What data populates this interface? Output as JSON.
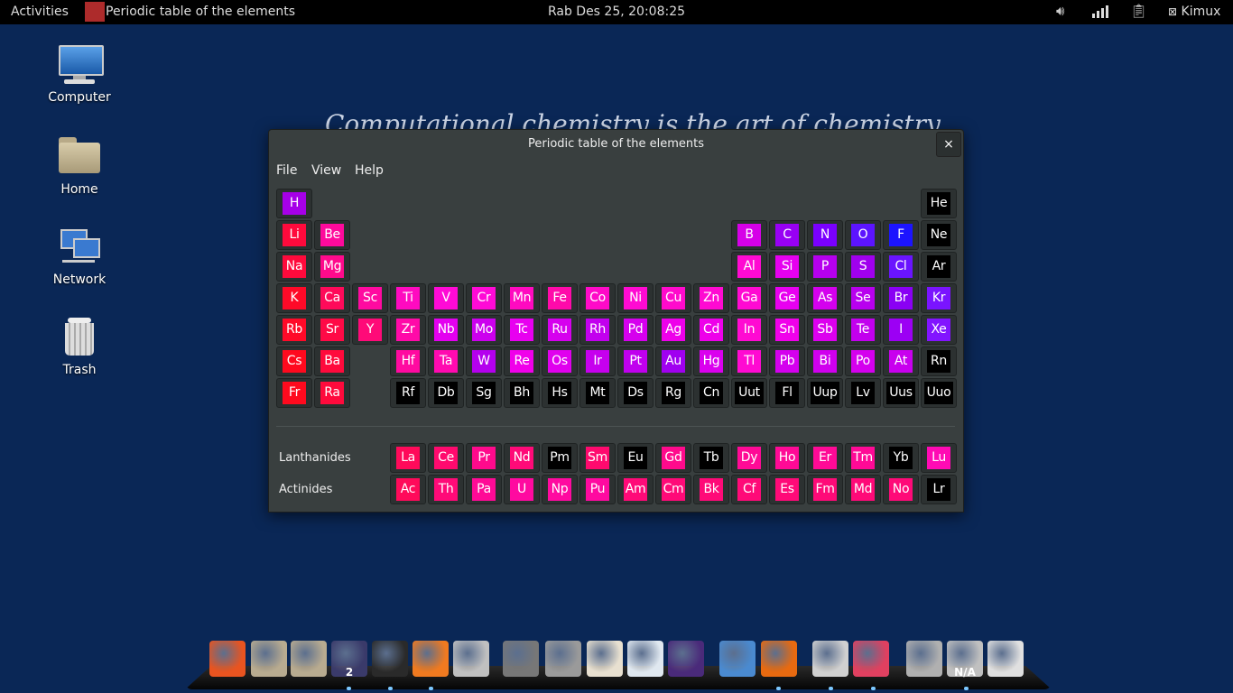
{
  "topbar": {
    "activities": "Activities",
    "app_title": "Periodic table of the elements",
    "clock": "Rab Des 25, 20:08:25",
    "user": "Kimux",
    "icons": [
      "volume-icon",
      "signal-icon",
      "clipboard-icon",
      "user-icon"
    ]
  },
  "desktop": {
    "icons": [
      {
        "label": "Computer",
        "icon": "computer-icon"
      },
      {
        "label": "Home",
        "icon": "home-folder-icon"
      },
      {
        "label": "Network",
        "icon": "network-icon"
      },
      {
        "label": "Trash",
        "icon": "trash-icon"
      }
    ],
    "quote": "Computational chemistry is the art of chemistry"
  },
  "window": {
    "title": "Periodic table of the elements",
    "close": "×",
    "menu": [
      "File",
      "View",
      "Help"
    ],
    "lanthanides_label": "Lanthanides",
    "actinides_label": "Actinides",
    "elements": [
      {
        "s": "H",
        "p": 1,
        "g": 1,
        "c": "#a600e8"
      },
      {
        "s": "He",
        "p": 1,
        "g": 18,
        "c": "#000000"
      },
      {
        "s": "Li",
        "p": 2,
        "g": 1,
        "c": "#ff0a3c"
      },
      {
        "s": "Be",
        "p": 2,
        "g": 2,
        "c": "#ff0a9c"
      },
      {
        "s": "B",
        "p": 2,
        "g": 13,
        "c": "#d600e8"
      },
      {
        "s": "C",
        "p": 2,
        "g": 14,
        "c": "#9800f4"
      },
      {
        "s": "N",
        "p": 2,
        "g": 15,
        "c": "#7a00ff"
      },
      {
        "s": "O",
        "p": 2,
        "g": 16,
        "c": "#5c14ff"
      },
      {
        "s": "F",
        "p": 2,
        "g": 17,
        "c": "#1c14ff"
      },
      {
        "s": "Ne",
        "p": 2,
        "g": 18,
        "c": "#000000"
      },
      {
        "s": "Na",
        "p": 3,
        "g": 1,
        "c": "#ff0a3c"
      },
      {
        "s": "Mg",
        "p": 3,
        "g": 2,
        "c": "#ff0a8c"
      },
      {
        "s": "Al",
        "p": 3,
        "g": 13,
        "c": "#ff0ad2"
      },
      {
        "s": "Si",
        "p": 3,
        "g": 14,
        "c": "#e600f0"
      },
      {
        "s": "P",
        "p": 3,
        "g": 15,
        "c": "#b600ee"
      },
      {
        "s": "S",
        "p": 3,
        "g": 16,
        "c": "#a000ee"
      },
      {
        "s": "Cl",
        "p": 3,
        "g": 17,
        "c": "#6a14ff"
      },
      {
        "s": "Ar",
        "p": 3,
        "g": 18,
        "c": "#000000"
      },
      {
        "s": "K",
        "p": 4,
        "g": 1,
        "c": "#ff0a28"
      },
      {
        "s": "Ca",
        "p": 4,
        "g": 2,
        "c": "#ff0a5a"
      },
      {
        "s": "Sc",
        "p": 4,
        "g": 3,
        "c": "#ff0aa0"
      },
      {
        "s": "Ti",
        "p": 4,
        "g": 4,
        "c": "#ff0ac0"
      },
      {
        "s": "V",
        "p": 4,
        "g": 5,
        "c": "#ff0ad6"
      },
      {
        "s": "Cr",
        "p": 4,
        "g": 6,
        "c": "#ff0ad6"
      },
      {
        "s": "Mn",
        "p": 4,
        "g": 7,
        "c": "#ff0ac0"
      },
      {
        "s": "Fe",
        "p": 4,
        "g": 8,
        "c": "#ff0aaa"
      },
      {
        "s": "Co",
        "p": 4,
        "g": 9,
        "c": "#ff0ac8"
      },
      {
        "s": "Ni",
        "p": 4,
        "g": 10,
        "c": "#ff0ad2"
      },
      {
        "s": "Cu",
        "p": 4,
        "g": 11,
        "c": "#ff0acc"
      },
      {
        "s": "Zn",
        "p": 4,
        "g": 12,
        "c": "#ff0ad2"
      },
      {
        "s": "Ga",
        "p": 4,
        "g": 13,
        "c": "#ff0ad2"
      },
      {
        "s": "Ge",
        "p": 4,
        "g": 14,
        "c": "#e800f0"
      },
      {
        "s": "As",
        "p": 4,
        "g": 15,
        "c": "#d400ee"
      },
      {
        "s": "Se",
        "p": 4,
        "g": 16,
        "c": "#b800ee"
      },
      {
        "s": "Br",
        "p": 4,
        "g": 17,
        "c": "#8a00f4"
      },
      {
        "s": "Kr",
        "p": 4,
        "g": 18,
        "c": "#7a14ff"
      },
      {
        "s": "Rb",
        "p": 5,
        "g": 1,
        "c": "#ff0a28"
      },
      {
        "s": "Sr",
        "p": 5,
        "g": 2,
        "c": "#ff0a46"
      },
      {
        "s": "Y",
        "p": 5,
        "g": 3,
        "c": "#ff0a78"
      },
      {
        "s": "Zr",
        "p": 5,
        "g": 4,
        "c": "#ff0aa8"
      },
      {
        "s": "Nb",
        "p": 5,
        "g": 5,
        "c": "#e400f0"
      },
      {
        "s": "Mo",
        "p": 5,
        "g": 6,
        "c": "#cc00ee"
      },
      {
        "s": "Tc",
        "p": 5,
        "g": 7,
        "c": "#e800f0"
      },
      {
        "s": "Ru",
        "p": 5,
        "g": 8,
        "c": "#d600ee"
      },
      {
        "s": "Rh",
        "p": 5,
        "g": 9,
        "c": "#c200ee"
      },
      {
        "s": "Pd",
        "p": 5,
        "g": 10,
        "c": "#d600ee"
      },
      {
        "s": "Ag",
        "p": 5,
        "g": 11,
        "c": "#ee00ea"
      },
      {
        "s": "Cd",
        "p": 5,
        "g": 12,
        "c": "#ee00ea"
      },
      {
        "s": "In",
        "p": 5,
        "g": 13,
        "c": "#ff0ad2"
      },
      {
        "s": "Sn",
        "p": 5,
        "g": 14,
        "c": "#f000ea"
      },
      {
        "s": "Sb",
        "p": 5,
        "g": 15,
        "c": "#dc00ee"
      },
      {
        "s": "Te",
        "p": 5,
        "g": 16,
        "c": "#c200ee"
      },
      {
        "s": "I",
        "p": 5,
        "g": 17,
        "c": "#9c00f4"
      },
      {
        "s": "Xe",
        "p": 5,
        "g": 18,
        "c": "#8214ff"
      },
      {
        "s": "Cs",
        "p": 6,
        "g": 1,
        "c": "#ff0a1e"
      },
      {
        "s": "Ba",
        "p": 6,
        "g": 2,
        "c": "#ff0a3c"
      },
      {
        "s": "Hf",
        "p": 6,
        "g": 4,
        "c": "#ff0aa0"
      },
      {
        "s": "Ta",
        "p": 6,
        "g": 5,
        "c": "#ff0ab0"
      },
      {
        "s": "W",
        "p": 6,
        "g": 6,
        "c": "#b400ee"
      },
      {
        "s": "Re",
        "p": 6,
        "g": 7,
        "c": "#f000ea"
      },
      {
        "s": "Os",
        "p": 6,
        "g": 8,
        "c": "#e000ee"
      },
      {
        "s": "Ir",
        "p": 6,
        "g": 9,
        "c": "#c600ee"
      },
      {
        "s": "Pt",
        "p": 6,
        "g": 10,
        "c": "#c000ee"
      },
      {
        "s": "Au",
        "p": 6,
        "g": 11,
        "c": "#a000f0"
      },
      {
        "s": "Hg",
        "p": 6,
        "g": 12,
        "c": "#da00ee"
      },
      {
        "s": "Tl",
        "p": 6,
        "g": 13,
        "c": "#ff0ad2"
      },
      {
        "s": "Pb",
        "p": 6,
        "g": 14,
        "c": "#d400ee"
      },
      {
        "s": "Bi",
        "p": 6,
        "g": 15,
        "c": "#d000ee"
      },
      {
        "s": "Po",
        "p": 6,
        "g": 16,
        "c": "#d400ee"
      },
      {
        "s": "At",
        "p": 6,
        "g": 17,
        "c": "#c800ee"
      },
      {
        "s": "Rn",
        "p": 6,
        "g": 18,
        "c": "#000000"
      },
      {
        "s": "Fr",
        "p": 7,
        "g": 1,
        "c": "#ff0a1e"
      },
      {
        "s": "Ra",
        "p": 7,
        "g": 2,
        "c": "#ff0a3c"
      },
      {
        "s": "Rf",
        "p": 7,
        "g": 4,
        "c": "#000000"
      },
      {
        "s": "Db",
        "p": 7,
        "g": 5,
        "c": "#000000"
      },
      {
        "s": "Sg",
        "p": 7,
        "g": 6,
        "c": "#000000"
      },
      {
        "s": "Bh",
        "p": 7,
        "g": 7,
        "c": "#000000"
      },
      {
        "s": "Hs",
        "p": 7,
        "g": 8,
        "c": "#000000"
      },
      {
        "s": "Mt",
        "p": 7,
        "g": 9,
        "c": "#000000"
      },
      {
        "s": "Ds",
        "p": 7,
        "g": 10,
        "c": "#000000"
      },
      {
        "s": "Rg",
        "p": 7,
        "g": 11,
        "c": "#000000"
      },
      {
        "s": "Cn",
        "p": 7,
        "g": 12,
        "c": "#000000"
      },
      {
        "s": "Uut",
        "p": 7,
        "g": 13,
        "c": "#000000"
      },
      {
        "s": "Fl",
        "p": 7,
        "g": 14,
        "c": "#000000"
      },
      {
        "s": "Uup",
        "p": 7,
        "g": 15,
        "c": "#000000"
      },
      {
        "s": "Lv",
        "p": 7,
        "g": 16,
        "c": "#000000"
      },
      {
        "s": "Uus",
        "p": 7,
        "g": 17,
        "c": "#000000"
      },
      {
        "s": "Uuo",
        "p": 7,
        "g": 18,
        "c": "#000000"
      }
    ],
    "lanthanides": [
      {
        "s": "La",
        "c": "#ff0a5a"
      },
      {
        "s": "Ce",
        "c": "#ff0a6e"
      },
      {
        "s": "Pr",
        "c": "#ff0a8c"
      },
      {
        "s": "Nd",
        "c": "#ff0a78"
      },
      {
        "s": "Pm",
        "c": "#000000"
      },
      {
        "s": "Sm",
        "c": "#ff0a6e"
      },
      {
        "s": "Eu",
        "c": "#000000"
      },
      {
        "s": "Gd",
        "c": "#ff0a8c"
      },
      {
        "s": "Tb",
        "c": "#000000"
      },
      {
        "s": "Dy",
        "c": "#ff0a96"
      },
      {
        "s": "Ho",
        "c": "#ff0a96"
      },
      {
        "s": "Er",
        "c": "#ff0a96"
      },
      {
        "s": "Tm",
        "c": "#ff0a96"
      },
      {
        "s": "Yb",
        "c": "#000000"
      },
      {
        "s": "Lu",
        "c": "#ff0ab4"
      }
    ],
    "actinides": [
      {
        "s": "Ac",
        "c": "#ff0a5a"
      },
      {
        "s": "Th",
        "c": "#ff0a78"
      },
      {
        "s": "Pa",
        "c": "#ff0a96"
      },
      {
        "s": "U",
        "c": "#ff0aa0"
      },
      {
        "s": "Np",
        "c": "#ff0aa0"
      },
      {
        "s": "Pu",
        "c": "#ff0aa0"
      },
      {
        "s": "Am",
        "c": "#ff0a78"
      },
      {
        "s": "Cm",
        "c": "#ff0a78"
      },
      {
        "s": "Bk",
        "c": "#ff0a78"
      },
      {
        "s": "Cf",
        "c": "#ff0a78"
      },
      {
        "s": "Es",
        "c": "#ff0a78"
      },
      {
        "s": "Fm",
        "c": "#ff0a78"
      },
      {
        "s": "Md",
        "c": "#ff0a78"
      },
      {
        "s": "No",
        "c": "#ff0a78"
      },
      {
        "s": "Lr",
        "c": "#000000"
      }
    ]
  },
  "dock": {
    "items": [
      {
        "name": "ubuntu-icon",
        "color": "#e95420"
      },
      {
        "name": "folder-icon",
        "color": "#b8ab90"
      },
      {
        "name": "folder-icon",
        "color": "#b8ab90"
      },
      {
        "name": "workspace-switcher-icon",
        "color": "#3a3a6a",
        "badge": "2"
      },
      {
        "name": "terminal-icon",
        "color": "#2a2a2a"
      },
      {
        "name": "software-center-icon",
        "color": "#f07a20"
      },
      {
        "name": "archive-manager-icon",
        "color": "#c0c0c0"
      },
      {
        "name": "gimp-icon",
        "color": "#777777"
      },
      {
        "name": "calculator-icon",
        "color": "#9a9a9a"
      },
      {
        "name": "presentation-icon",
        "color": "#e8e0d0"
      },
      {
        "name": "document-viewer-icon",
        "color": "#e0e8f0"
      },
      {
        "name": "eclipse-icon",
        "color": "#4a2a7a"
      },
      {
        "name": "chromium-icon",
        "color": "#4a8ad0"
      },
      {
        "name": "firefox-icon",
        "color": "#e86a10"
      },
      {
        "name": "file-cabinet-icon",
        "color": "#d0d0d0"
      },
      {
        "name": "periodic-table-icon",
        "color": "#e04060"
      },
      {
        "name": "camera-icon",
        "color": "#b0b0b0"
      },
      {
        "name": "weather-icon",
        "color": "#c0c0c0",
        "badge": "N/A"
      },
      {
        "name": "power-switch-icon",
        "color": "#e0e0e0"
      }
    ]
  }
}
